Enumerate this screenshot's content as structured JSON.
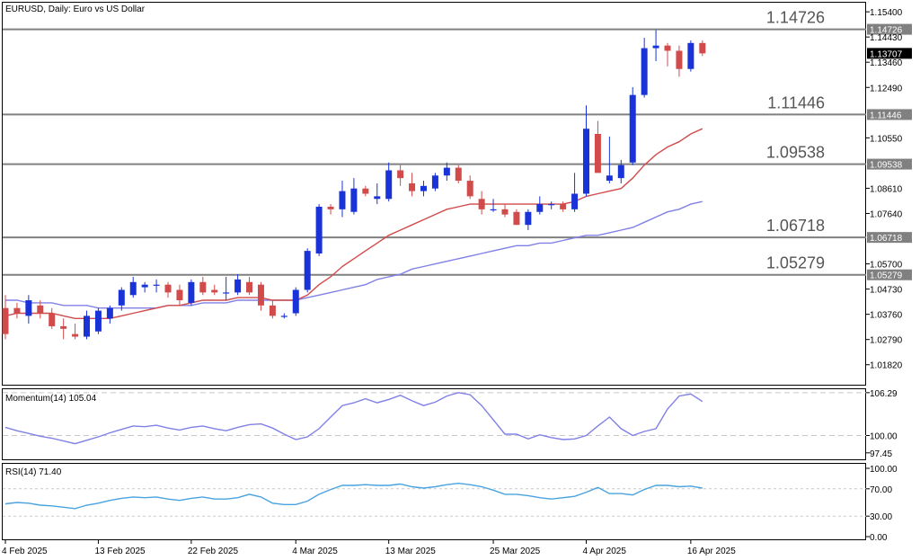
{
  "header": {
    "main_title": "EURUSD, Daily:  Euro vs US Dollar",
    "momentum_title": "Momentum(14) 105.04",
    "rsi_title": "RSI(14) 71.40"
  },
  "colors": {
    "bull": "#1a33d9",
    "bear": "#d24b4b",
    "ma_fast": "#d24b4b",
    "ma_slow": "#8080e6",
    "momentum": "#8080e6",
    "rsi": "#4aa3df",
    "level_line": "#808080",
    "current_price_bg": "#000000"
  },
  "price_axis_labels": [
    "1.15400",
    "1.14430",
    "1.13460",
    "1.12490",
    "1.10550",
    "1.08610",
    "1.07640",
    "1.05700",
    "1.04730",
    "1.03760",
    "1.02790",
    "1.01820"
  ],
  "momentum_axis_labels": [
    "106.29",
    "100.00",
    "97.45"
  ],
  "rsi_axis_labels": [
    "100.00",
    "70.00",
    "30.00",
    "0.00"
  ],
  "date_labels": [
    "4 Feb 2025",
    "13 Feb 2025",
    "22 Feb 2025",
    "4 Mar 2025",
    "13 Mar 2025",
    "25 Mar 2025",
    "4 Apr 2025",
    "16 Apr 2025"
  ],
  "current_price_label": "1.13707",
  "chart_data": [
    {
      "type": "candlestick",
      "title": "EURUSD, Daily:  Euro vs US Dollar",
      "ylim": [
        1.0105,
        1.1575
      ],
      "price_levels": [
        {
          "value": 1.14726,
          "label": "1.14726"
        },
        {
          "value": 1.11446,
          "label": "1.11446"
        },
        {
          "value": 1.09538,
          "label": "1.09538"
        },
        {
          "value": 1.06718,
          "label": "1.06718"
        },
        {
          "value": 1.05279,
          "label": "1.05279"
        }
      ],
      "ohlc": [
        [
          1.04,
          1.045,
          1.028,
          1.03
        ],
        [
          1.04,
          1.042,
          1.036,
          1.038
        ],
        [
          1.037,
          1.045,
          1.034,
          1.043
        ],
        [
          1.041,
          1.043,
          1.036,
          1.038
        ],
        [
          1.038,
          1.04,
          1.032,
          1.033
        ],
        [
          1.033,
          1.036,
          1.028,
          1.032
        ],
        [
          1.03,
          1.034,
          1.028,
          1.029
        ],
        [
          1.029,
          1.039,
          1.028,
          1.037
        ],
        [
          1.031,
          1.04,
          1.03,
          1.039
        ],
        [
          1.036,
          1.041,
          1.034,
          1.04
        ],
        [
          1.041,
          1.048,
          1.039,
          1.047
        ],
        [
          1.045,
          1.052,
          1.044,
          1.05
        ],
        [
          1.048,
          1.05,
          1.046,
          1.049
        ],
        [
          1.049,
          1.051,
          1.046,
          1.049
        ],
        [
          1.049,
          1.05,
          1.044,
          1.046
        ],
        [
          1.047,
          1.049,
          1.041,
          1.043
        ],
        [
          1.042,
          1.051,
          1.041,
          1.05
        ],
        [
          1.05,
          1.052,
          1.045,
          1.046
        ],
        [
          1.047,
          1.049,
          1.045,
          1.046
        ],
        [
          1.046,
          1.052,
          1.043,
          1.046
        ],
        [
          1.046,
          1.053,
          1.045,
          1.051
        ],
        [
          1.05,
          1.052,
          1.045,
          1.046
        ],
        [
          1.049,
          1.05,
          1.039,
          1.041
        ],
        [
          1.041,
          1.043,
          1.036,
          1.037
        ],
        [
          1.037,
          1.038,
          1.036,
          1.037
        ],
        [
          1.038,
          1.048,
          1.037,
          1.047
        ],
        [
          1.047,
          1.063,
          1.046,
          1.062
        ],
        [
          1.061,
          1.08,
          1.06,
          1.079
        ],
        [
          1.079,
          1.08,
          1.076,
          1.078
        ],
        [
          1.078,
          1.089,
          1.075,
          1.085
        ],
        [
          1.077,
          1.09,
          1.076,
          1.086
        ],
        [
          1.086,
          1.087,
          1.083,
          1.084
        ],
        [
          1.082,
          1.088,
          1.08,
          1.083
        ],
        [
          1.082,
          1.096,
          1.081,
          1.093
        ],
        [
          1.093,
          1.095,
          1.087,
          1.09
        ],
        [
          1.088,
          1.092,
          1.083,
          1.085
        ],
        [
          1.085,
          1.089,
          1.083,
          1.087
        ],
        [
          1.086,
          1.092,
          1.085,
          1.091
        ],
        [
          1.091,
          1.096,
          1.089,
          1.094
        ],
        [
          1.094,
          1.095,
          1.088,
          1.089
        ],
        [
          1.089,
          1.091,
          1.082,
          1.083
        ],
        [
          1.082,
          1.085,
          1.076,
          1.078
        ],
        [
          1.078,
          1.082,
          1.077,
          1.078
        ],
        [
          1.078,
          1.08,
          1.075,
          1.076
        ],
        [
          1.077,
          1.078,
          1.072,
          1.072
        ],
        [
          1.072,
          1.078,
          1.07,
          1.077
        ],
        [
          1.077,
          1.083,
          1.076,
          1.08
        ],
        [
          1.08,
          1.081,
          1.078,
          1.08
        ],
        [
          1.08,
          1.081,
          1.077,
          1.078
        ],
        [
          1.078,
          1.092,
          1.077,
          1.084
        ],
        [
          1.084,
          1.118,
          1.083,
          1.109
        ],
        [
          1.107,
          1.112,
          1.093,
          1.092
        ],
        [
          1.089,
          1.106,
          1.088,
          1.091
        ],
        [
          1.09,
          1.097,
          1.088,
          1.095
        ],
        [
          1.096,
          1.125,
          1.095,
          1.122
        ],
        [
          1.122,
          1.144,
          1.121,
          1.14
        ],
        [
          1.14,
          1.147,
          1.135,
          1.141
        ],
        [
          1.141,
          1.142,
          1.133,
          1.139
        ],
        [
          1.139,
          1.141,
          1.129,
          1.132
        ],
        [
          1.132,
          1.143,
          1.131,
          1.142
        ],
        [
          1.142,
          1.143,
          1.137,
          1.138
        ]
      ],
      "ma_fast": [
        1.037,
        1.038,
        1.038,
        1.038,
        1.038,
        1.037,
        1.036,
        1.036,
        1.036,
        1.036,
        1.037,
        1.038,
        1.039,
        1.04,
        1.041,
        1.041,
        1.042,
        1.043,
        1.043,
        1.043,
        1.044,
        1.044,
        1.044,
        1.043,
        1.043,
        1.043,
        1.045,
        1.049,
        1.052,
        1.056,
        1.059,
        1.062,
        1.065,
        1.068,
        1.07,
        1.072,
        1.074,
        1.076,
        1.078,
        1.079,
        1.08,
        1.08,
        1.08,
        1.08,
        1.08,
        1.08,
        1.08,
        1.08,
        1.08,
        1.081,
        1.083,
        1.084,
        1.085,
        1.086,
        1.09,
        1.095,
        1.099,
        1.102,
        1.104,
        1.107,
        1.109
      ],
      "ma_slow": [
        1.043,
        1.043,
        1.042,
        1.042,
        1.042,
        1.041,
        1.041,
        1.041,
        1.04,
        1.04,
        1.04,
        1.04,
        1.04,
        1.04,
        1.041,
        1.041,
        1.041,
        1.042,
        1.042,
        1.042,
        1.043,
        1.043,
        1.043,
        1.043,
        1.043,
        1.043,
        1.044,
        1.045,
        1.046,
        1.047,
        1.048,
        1.049,
        1.051,
        1.052,
        1.053,
        1.055,
        1.056,
        1.057,
        1.058,
        1.059,
        1.06,
        1.061,
        1.062,
        1.063,
        1.064,
        1.064,
        1.065,
        1.065,
        1.066,
        1.067,
        1.068,
        1.068,
        1.069,
        1.07,
        1.071,
        1.073,
        1.075,
        1.077,
        1.078,
        1.08,
        1.081
      ]
    },
    {
      "type": "line",
      "title": "Momentum(14) 105.04",
      "ylim": [
        96.5,
        106.8
      ],
      "reference_levels": [
        100.0,
        106.29
      ],
      "values": [
        101.2,
        100.7,
        100.3,
        99.9,
        99.6,
        99.2,
        98.8,
        99.3,
        99.8,
        100.4,
        100.9,
        101.4,
        101.3,
        101.5,
        101.1,
        100.8,
        101.2,
        101.4,
        101.0,
        100.7,
        101.2,
        101.6,
        101.7,
        101.1,
        100.2,
        99.4,
        99.8,
        101.0,
        102.7,
        104.4,
        104.8,
        105.4,
        104.8,
        105.3,
        105.9,
        105.1,
        104.4,
        104.9,
        105.8,
        106.3,
        106.0,
        104.4,
        102.3,
        100.2,
        100.2,
        99.5,
        100.1,
        99.7,
        99.4,
        99.5,
        100.0,
        101.4,
        102.7,
        101.0,
        100.0,
        100.6,
        101.0,
        103.9,
        105.8,
        106.1,
        105.0
      ]
    },
    {
      "type": "line",
      "title": "RSI(14) 71.40",
      "ylim": [
        0,
        100
      ],
      "reference_levels": [
        70,
        30
      ],
      "values": [
        48,
        50,
        49,
        46,
        45,
        43,
        41,
        46,
        49,
        53,
        56,
        58,
        57,
        58,
        55,
        53,
        56,
        58,
        55,
        55,
        57,
        62,
        58,
        49,
        47,
        47,
        52,
        62,
        69,
        75,
        75,
        76,
        75,
        75,
        77,
        73,
        71,
        73,
        76,
        78,
        76,
        73,
        68,
        62,
        62,
        60,
        57,
        55,
        57,
        59,
        65,
        72,
        63,
        63,
        61,
        69,
        75,
        75,
        73,
        74,
        71
      ]
    }
  ]
}
